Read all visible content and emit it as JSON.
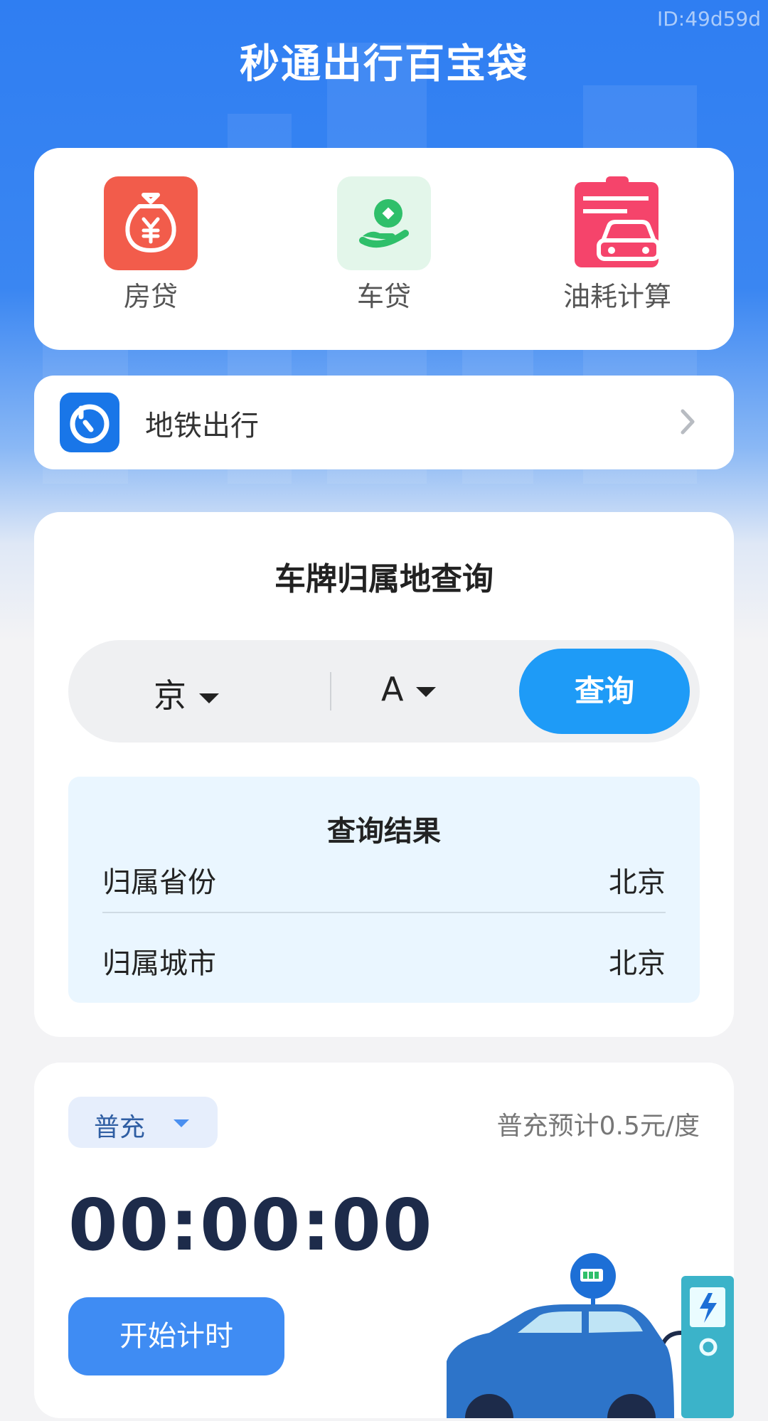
{
  "watermark": "ID:49d59d",
  "app_title": "秒通出行百宝袋",
  "tools": [
    {
      "label": "房贷"
    },
    {
      "label": "车贷"
    },
    {
      "label": "油耗计算"
    }
  ],
  "metro": {
    "label": "地铁出行"
  },
  "plate_query": {
    "title": "车牌归属地查询",
    "province": "京",
    "letter": "A",
    "query_button": "查询",
    "result_title": "查询结果",
    "rows": [
      {
        "label": "归属省份",
        "value": "北京"
      },
      {
        "label": "归属城市",
        "value": "北京"
      }
    ]
  },
  "charging": {
    "mode": "普充",
    "price_note": "普充预计0.5元/度",
    "timer": "00:00:00",
    "start_button": "开始计时"
  },
  "colors": {
    "brand_blue": "#2f7ef2",
    "query_blue": "#1e9bf7",
    "start_blue": "#3f8cf3"
  }
}
